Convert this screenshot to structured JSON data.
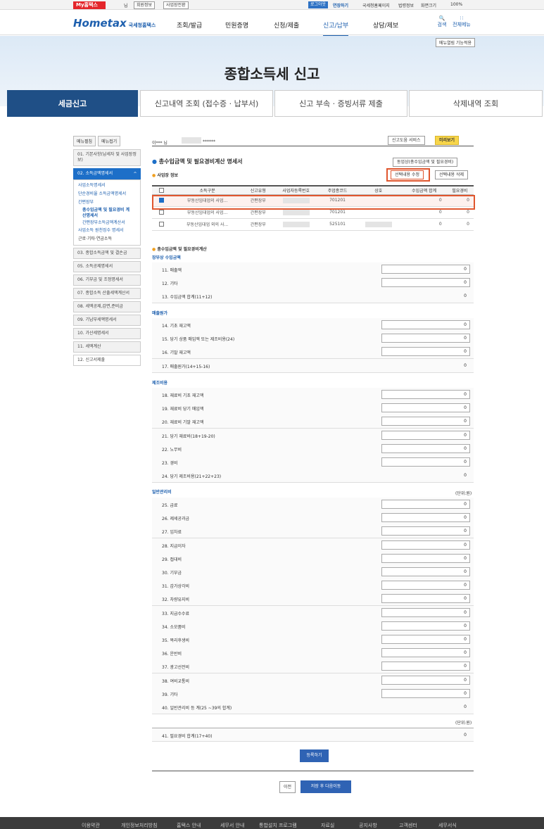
{
  "util": {
    "my_home": "My홈택스",
    "user_suffix": "님",
    "member_info": "회원정보",
    "biz_switch": "사업장전환",
    "logout": "로그아웃",
    "contact": "연장하기",
    "home": "국세청홈페이지",
    "law": "법령정보",
    "zoom": "화면크기",
    "zoom_val": "100%"
  },
  "header": {
    "logo": "Hometax",
    "logo_sub": "국세청홈택스",
    "nav": [
      "조회/발급",
      "민원증명",
      "신청/제출",
      "신고/납부",
      "상담/제보"
    ],
    "search": "검색",
    "all_menu": "전체메뉴"
  },
  "banner": {
    "menu_fix": "메뉴열림 기능적용",
    "title": "종합소득세 신고"
  },
  "tabs": [
    "세금신고",
    "신고내역 조회 (접수증 · 납부서)",
    "신고 부속 · 증빙서류 제출",
    "삭제내역 조회"
  ],
  "left": {
    "open": "메뉴펼침",
    "close": "메뉴접기",
    "items": [
      "01. 기본사항(납세자 및 사업장정보)",
      "02. 소득금액명세서",
      "03. 종합소득금액 및 결손금",
      "05. 소득공제명세서",
      "06. 기부금 및 조정명세서",
      "07. 종합소득 산출세액계산서",
      "08. 세액공제,감면,준비금",
      "09. 기납부세액명세서",
      "10. 가산세명세서",
      "11. 세액계산",
      "12. 신고서제출"
    ],
    "subs": [
      "사업소득명세서",
      "단순경비율 소득금액명세서",
      "간편장부",
      "총수입금액 및 필요경비 계산명세서",
      "간편장부소득금액계산서",
      "사업소득 원천징수 명세서",
      "근로·기타·연금소득"
    ]
  },
  "content": {
    "user": "이*** 님",
    "user_id": "******",
    "help": "신고도움 서비스",
    "preview": "미리보기",
    "section_title": "총수입금액 및 필요경비계산 명세서",
    "same_btn": "동업상(총수입금액 및 필요경비)",
    "biz_info": "사업장 정보",
    "edit_btn": "선택내용 수정",
    "del_btn": "선택내용 삭제",
    "table_headers": [
      "소득구분",
      "신고유형",
      "사업자등록번호",
      "주업종코드",
      "상호",
      "수입금액 합계",
      "필요경비"
    ],
    "table_rows": [
      {
        "type": "부동산임대업의 사업...",
        "report": "간편장부",
        "code": "701201",
        "income": "0",
        "expense": "0"
      },
      {
        "type": "부동산임대업의 사업...",
        "report": "간편장부",
        "code": "701201",
        "income": "0",
        "expense": "0"
      },
      {
        "type": "부동산임대업 외의 사...",
        "report": "간편장부",
        "code": "525101",
        "income": "0",
        "expense": "0"
      }
    ],
    "calc_title": "총수입금액 및 필요경비계산",
    "g1": "장부상 수입금액",
    "g2": "매출원가",
    "g3": "제조비용",
    "g4": "일반관리비",
    "unit": "(단위:원)",
    "rows1": [
      [
        "11. 매출액",
        "0"
      ],
      [
        "12. 기타",
        "0"
      ],
      [
        "13. 수입금액 합계(11+12)",
        "0"
      ]
    ],
    "rows2": [
      [
        "14. 기초 재고액",
        "0"
      ],
      [
        "15. 당기 상품 매입액 또는 제조비용(24)",
        "0"
      ],
      [
        "16. 기말 재고액",
        "0"
      ],
      [
        "17. 매출원가(14+15-16)",
        "0"
      ]
    ],
    "rows3": [
      [
        "18. 재료비 기초 재고액",
        "0"
      ],
      [
        "19. 재료비 당기 매입액",
        "0"
      ],
      [
        "20. 재료비 기말 재고액",
        "0"
      ],
      [
        "21. 당기 재료비(18+19-20)",
        "0"
      ],
      [
        "22. 노무비",
        "0"
      ],
      [
        "23. 경비",
        "0"
      ],
      [
        "24. 당기 제조비용(21+22+23)",
        "0"
      ]
    ],
    "rows4": [
      [
        "25. 급료",
        "0"
      ],
      [
        "26. 제세공과금",
        "0"
      ],
      [
        "27. 임차료",
        "0"
      ],
      [
        "28. 지급이자",
        "0"
      ],
      [
        "29. 접대비",
        "0"
      ],
      [
        "30. 기부금",
        "0"
      ],
      [
        "31. 감가상각비",
        "0"
      ],
      [
        "32. 차량유지비",
        "0"
      ],
      [
        "33. 지급수수료",
        "0"
      ],
      [
        "34. 소모품비",
        "0"
      ],
      [
        "35. 복리후생비",
        "0"
      ],
      [
        "36. 운반비",
        "0"
      ],
      [
        "37. 광고선전비",
        "0"
      ],
      [
        "38. 여비교통비",
        "0"
      ],
      [
        "39. 기타",
        "0"
      ],
      [
        "40. 일반관리비 등 계(25 ~39의 합계)",
        "0"
      ]
    ],
    "total": [
      "41. 필요경비 합계(17+40)",
      "0"
    ],
    "register": "등록하기",
    "prev": "이전",
    "save_next": "저장 후 다음이동"
  },
  "footer": [
    "이용약관",
    "개인정보처리방침",
    "홈택스 안내",
    "세무서 안내",
    "통합설치 프로그램",
    "자료실",
    "공지사항",
    "고객센터",
    "세무서식"
  ]
}
